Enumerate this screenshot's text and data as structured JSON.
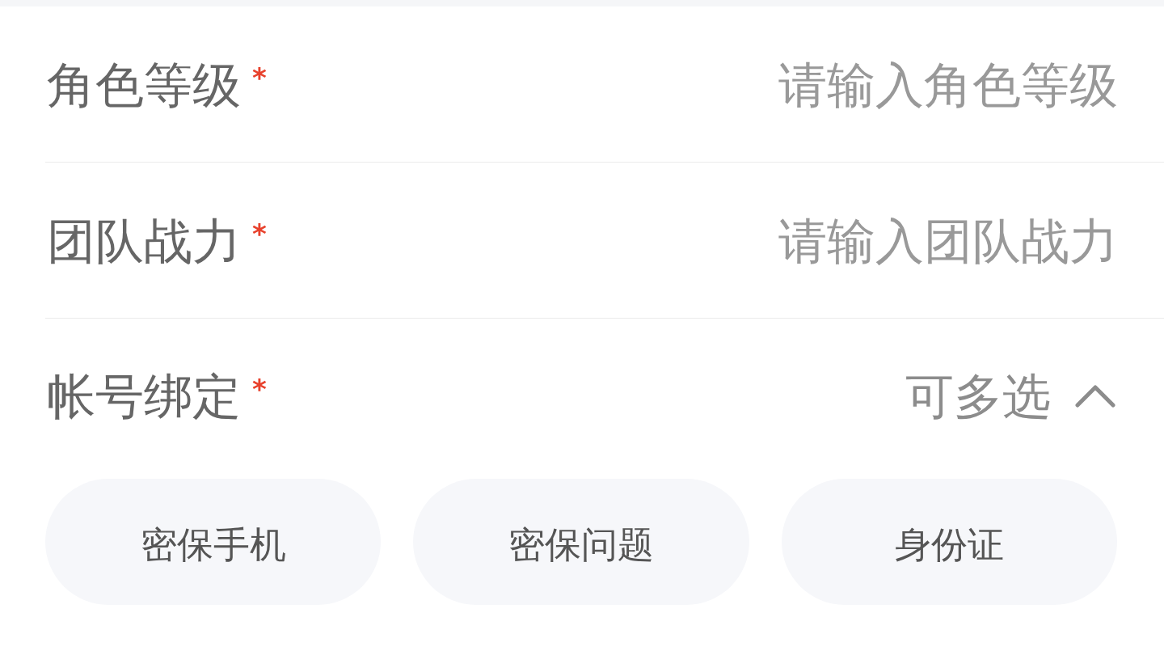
{
  "fields": [
    {
      "kind": "input",
      "label": "角色等级",
      "required_mark": "*",
      "placeholder": "请输入角色等级"
    },
    {
      "kind": "input",
      "label": "团队战力",
      "required_mark": "*",
      "placeholder": "请输入团队战力"
    },
    {
      "kind": "multiselect",
      "label": "帐号绑定",
      "required_mark": "*",
      "hint": "可多选",
      "expanded": true,
      "options": [
        {
          "label": "密保手机",
          "selected": false
        },
        {
          "label": "密保问题",
          "selected": false
        },
        {
          "label": "身份证",
          "selected": false
        }
      ]
    }
  ]
}
